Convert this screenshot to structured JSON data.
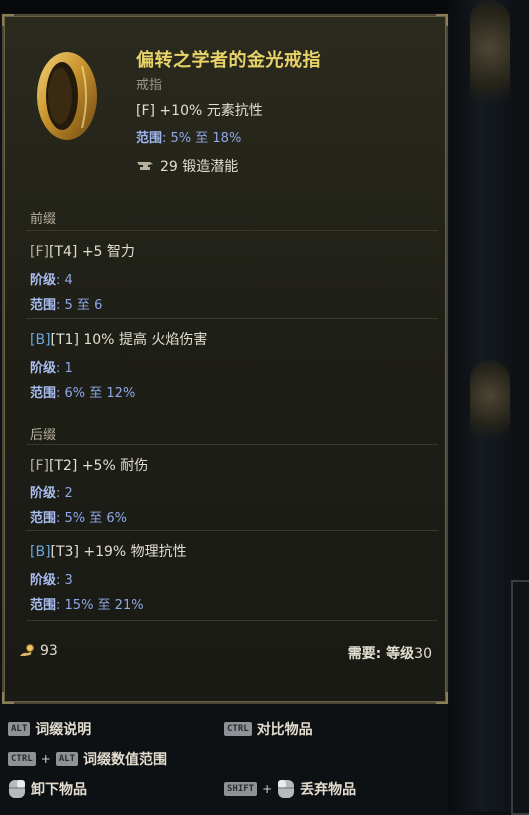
{
  "item": {
    "name": "偏转之学者的金光戒指",
    "type": "戒指",
    "implicit": "[F] +10% 元素抗性",
    "implicit_range_label": "范围",
    "implicit_range_value": ": 5% 至 18%",
    "forge_value": "29 锻造潜能",
    "icon": "gold-ring-icon"
  },
  "prefix": {
    "label": "前缀",
    "mods": [
      {
        "tag": "[F]",
        "tier": "[T4]",
        "text": " +5 智力",
        "tier_label": "阶级",
        "tier_value": ": 4",
        "range_label": "范围",
        "range_value": ": 5 至 6"
      },
      {
        "tag": "[B]",
        "tier": "[T1]",
        "text": " 10% 提高 火焰伤害",
        "tier_label": "阶级",
        "tier_value": ": 1",
        "range_label": "范围",
        "range_value": ": 6% 至 12%"
      }
    ]
  },
  "suffix": {
    "label": "后缀",
    "mods": [
      {
        "tag": "[F]",
        "tier": "[T2]",
        "text": " +5% 耐伤",
        "tier_label": "阶级",
        "tier_value": ": 2",
        "range_label": "范围",
        "range_value": ": 5% 至 6%"
      },
      {
        "tag": "[B]",
        "tier": "[T3]",
        "text": " +19% 物理抗性",
        "tier_label": "阶级",
        "tier_value": ": 3",
        "range_label": "范围",
        "range_value": ": 15% 至 21%"
      }
    ]
  },
  "footer": {
    "value": "93",
    "value_icon": "coin-hand-icon",
    "requirement_label": "需要: 等级",
    "requirement_value": "30"
  },
  "hints": {
    "alt_key": "ALT",
    "affix_desc": "词缀说明",
    "ctrl_key": "CTRL",
    "compare": "对比物品",
    "ctrl_key2": "CTRL",
    "plus": "+",
    "alt_key2": "ALT",
    "affix_range": "词缀数值范围",
    "unequip": "卸下物品",
    "shift_key": "SHIFT",
    "plus2": "+",
    "drop": "丢弃物品"
  },
  "colors": {
    "title": "#e8d36a",
    "range": "#8fa7e6",
    "tag_b": "#6aa7e0",
    "panel_border": "#4a4534"
  }
}
